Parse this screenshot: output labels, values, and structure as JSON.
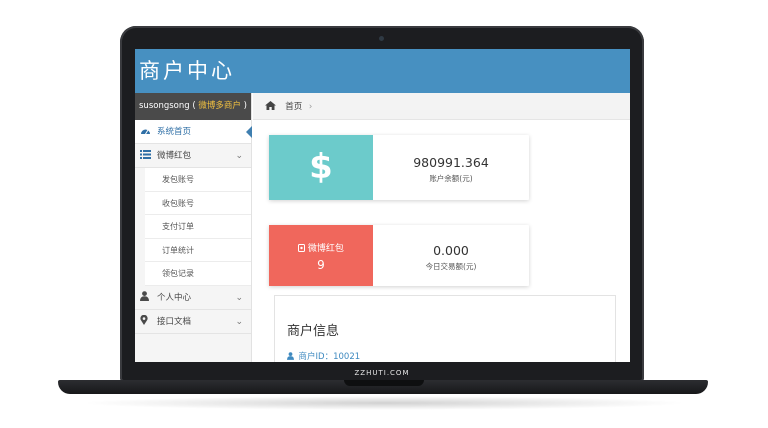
{
  "device": {
    "brand_label": "ZZHUTI.COM"
  },
  "app": {
    "title": "商户中心"
  },
  "sidebar": {
    "user": {
      "name": "susongsong",
      "open_paren": "(",
      "tag": "微博多商户",
      "close_paren": ")"
    },
    "items": [
      {
        "label": "系统首页",
        "icon": "dashboard-icon",
        "active": true
      },
      {
        "label": "微博红包",
        "icon": "list-icon",
        "expanded": true,
        "children": [
          "发包账号",
          "收包账号",
          "支付订单",
          "订单统计",
          "领包记录"
        ]
      },
      {
        "label": "个人中心",
        "icon": "user-icon"
      },
      {
        "label": "接口文档",
        "icon": "location-pin-icon"
      }
    ]
  },
  "breadcrumb": {
    "home_icon": "home-icon",
    "label": "首页",
    "separator": "›"
  },
  "cards": {
    "balance": {
      "icon_glyph": "$",
      "value": "980991.364",
      "caption": "账户余额(元)",
      "color": "#6ccbcb"
    },
    "redpacket": {
      "label": "微博红包",
      "count": "9",
      "value": "0.000",
      "caption": "今日交易额(元)",
      "color": "#f0675c"
    }
  },
  "merchant": {
    "title": "商户信息",
    "id_label": "商户ID：10021"
  }
}
